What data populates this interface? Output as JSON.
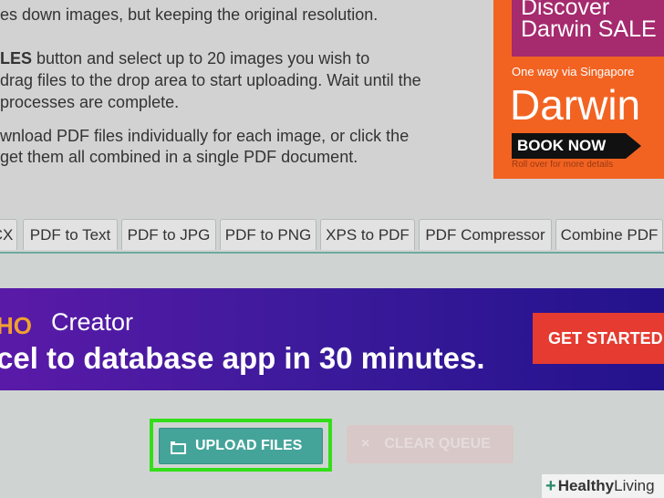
{
  "instructions": {
    "line1": "es down images, but keeping the original resolution.",
    "line2_bold": "LES",
    "line2_rest": " button and select up to 20 images you wish to",
    "line3": "drag files to the drop area to start uploading. Wait until the",
    "line4": " processes are complete.",
    "line5": "wnload PDF files individually for each image, or click the",
    "line6": " get them all combined in a single PDF document."
  },
  "ad_right": {
    "line1": "Discover",
    "line2": "Darwin SALE",
    "subtitle": "One way via Singapore",
    "headline": "Darwin",
    "book_label": "BOOK NOW",
    "roll_note": "Roll over for more details"
  },
  "tabs": [
    {
      "label": "CX"
    },
    {
      "label": "PDF to Text"
    },
    {
      "label": "PDF to JPG"
    },
    {
      "label": "PDF to PNG"
    },
    {
      "label": "XPS to PDF"
    },
    {
      "label": "PDF Compressor"
    },
    {
      "label": "Combine PDF"
    }
  ],
  "banner": {
    "logo_text": "HO",
    "product": "Creator",
    "headline": "cel to database app in 30 minutes.",
    "cta_label": "GET STARTED"
  },
  "actions": {
    "upload_label": "UPLOAD FILES",
    "clear_label": "CLEAR QUEUE",
    "clear_icon": "×"
  },
  "watermark": {
    "plus": "+",
    "healthy": "Healthy",
    "living": " Living"
  },
  "colors": {
    "upload_bg": "#45a49a",
    "highlight": "#33dd1a",
    "cta_bg": "#e53b30"
  }
}
